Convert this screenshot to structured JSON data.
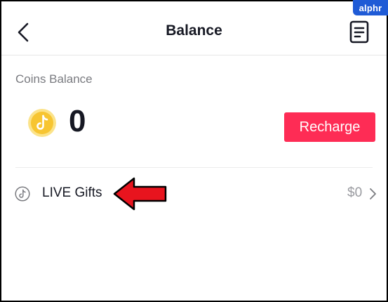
{
  "watermark": {
    "text": "alphr"
  },
  "header": {
    "title": "Balance"
  },
  "coins": {
    "label": "Coins Balance",
    "value": "0"
  },
  "actions": {
    "recharge_label": "Recharge"
  },
  "gifts": {
    "label": "LIVE Gifts",
    "amount": "$0"
  },
  "colors": {
    "accent": "#fe2c55",
    "coin": "#f7c531",
    "text": "#161823",
    "muted": "#7a7b80",
    "watermark": "#1f5bd6",
    "annotation_arrow": "#e8141e"
  },
  "icons": {
    "back": "chevron-left-icon",
    "transactions": "document-list-icon",
    "coin": "tiktok-coin-icon",
    "gifts": "tiktok-note-icon",
    "row": "chevron-right-icon",
    "annotation": "red-arrow-icon"
  }
}
